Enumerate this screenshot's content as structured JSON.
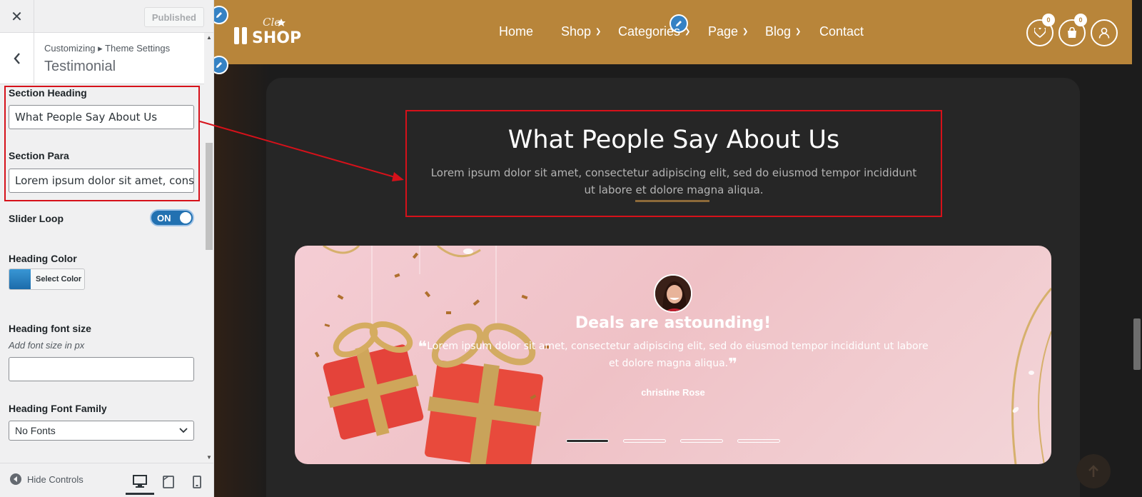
{
  "customizer": {
    "close_label": "✕",
    "published_label": "Published",
    "breadcrumb": "Customizing ▸ Theme Settings",
    "section_title": "Testimonial",
    "controls": {
      "section_heading_label": "Section Heading",
      "section_heading_value": "What People Say About Us",
      "section_para_label": "Section Para",
      "section_para_value": "Lorem ipsum dolor sit amet, consectetur",
      "slider_loop_label": "Slider Loop",
      "slider_loop_state": "ON",
      "heading_color_label": "Heading Color",
      "select_color_label": "Select Color",
      "heading_font_size_label": "Heading font size",
      "heading_font_size_hint": "Add font size in px",
      "heading_font_size_value": "",
      "heading_font_family_label": "Heading Font Family",
      "heading_font_family_value": "No Fonts"
    },
    "footer": {
      "hide_controls_label": "Hide Controls"
    }
  },
  "preview": {
    "nav": {
      "items": [
        {
          "label": "Home",
          "has_dropdown": false
        },
        {
          "label": "Shop",
          "has_dropdown": true
        },
        {
          "label": "Categories",
          "has_dropdown": true
        },
        {
          "label": "Page",
          "has_dropdown": true
        },
        {
          "label": "Blog",
          "has_dropdown": true
        },
        {
          "label": "Contact",
          "has_dropdown": false
        }
      ],
      "wishlist_count": "0",
      "cart_count": "0"
    },
    "testimonial": {
      "heading": "What People Say About Us",
      "para": "Lorem ipsum dolor sit amet, consectetur adipiscing elit, sed do eiusmod tempor incididunt ut labore et dolore magna aliqua.",
      "slide": {
        "title": "Deals are astounding!",
        "quote": "Lorem ipsum dolor sit amet, consectetur adipiscing elit, sed do eiusmod tempor incididunt ut labore et dolore magna aliqua.",
        "author": "christine Rose"
      },
      "slide_count": 4,
      "active_slide": 1
    }
  },
  "colors": {
    "nav_bg": "#b8853a",
    "accent_blue": "#2271b1",
    "highlight_red": "#d6111a"
  }
}
